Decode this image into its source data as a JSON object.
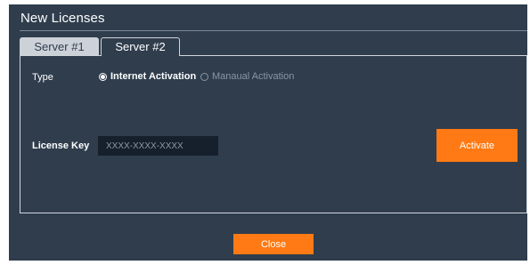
{
  "dialog": {
    "title": "New Licenses"
  },
  "tabs": [
    {
      "label": "Server #1",
      "active": false
    },
    {
      "label": "Server #2",
      "active": true
    }
  ],
  "form": {
    "type_label": "Type",
    "options": [
      {
        "label": "Internet Activation",
        "selected": true
      },
      {
        "label": "Manaual Activation",
        "selected": false
      }
    ],
    "license_key_label": "License Key",
    "license_key_placeholder": "XXXX-XXXX-XXXX",
    "license_key_value": ""
  },
  "buttons": {
    "activate_label": "Activate",
    "close_label": "Close"
  },
  "colors": {
    "dialog_bg": "#2f3d4d",
    "accent": "#ff7a14",
    "input_bg": "#16202c"
  }
}
